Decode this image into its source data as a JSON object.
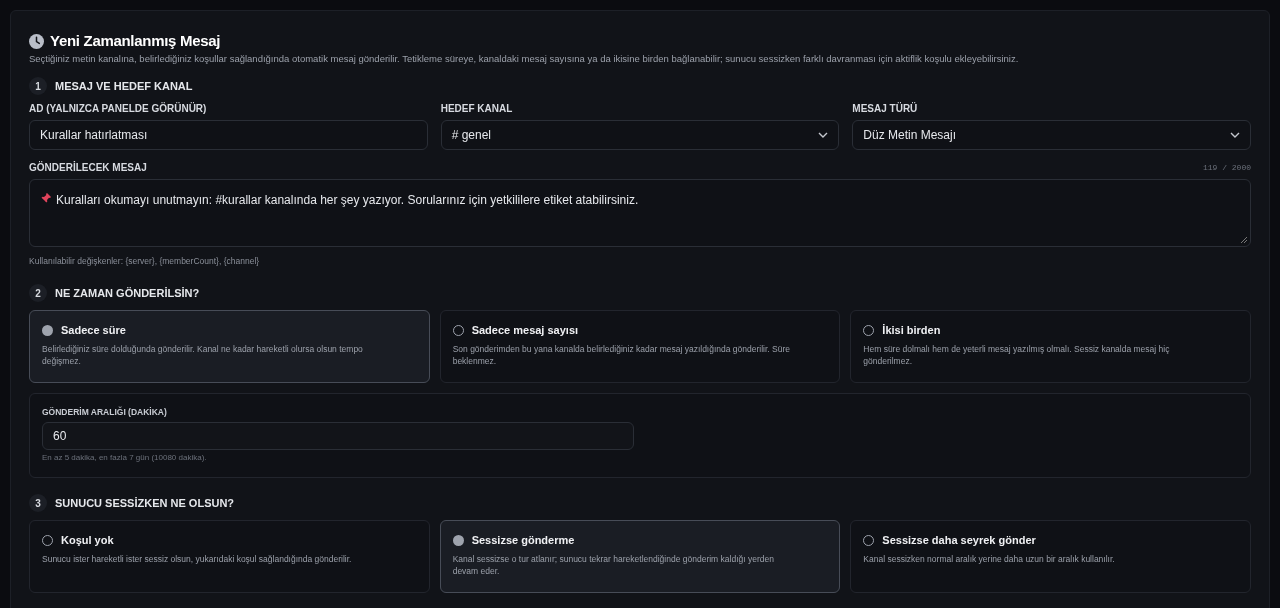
{
  "header": {
    "title": "Yeni Zamanlanmış Mesaj",
    "description": "Seçtiğiniz metin kanalına, belirlediğiniz koşullar sağlandığında otomatik mesaj gönderilir. Tetikleme süreye, kanaldaki mesaj sayısına ya da ikisine birden bağlanabilir; sunucu sessizken farklı davranması için aktiflik koşulu ekleyebilirsiniz."
  },
  "section_1": {
    "number": "1",
    "title": "MESAJ VE HEDEF KANAL",
    "fields": [
      {
        "kind": "text",
        "label": "AD (YALNIZCA PANELDE GÖRÜNÜR)",
        "value": "Kurallar hatırlatması"
      },
      {
        "kind": "select",
        "label": "HEDEF KANAL",
        "value": "# genel"
      },
      {
        "kind": "select",
        "label": "MESAJ TÜRÜ",
        "value": "Düz Metin Mesajı"
      }
    ],
    "message": {
      "label": "GÖNDERİLECEK MESAJ",
      "counter": "119 / 2000",
      "value": "Kuralları okumayı unutmayın: #kurallar kanalında her şey yazıyor. Sorularınız için yetkililere etiket atabilirsiniz.",
      "hint": "Kullanılabilir değişkenler: {server}, {memberCount}, {channel}"
    }
  },
  "section_2": {
    "number": "2",
    "title": "NE ZAMAN GÖNDERİLSİN?",
    "options": [
      {
        "title": "Sadece süre",
        "description": "Belirlediğiniz süre dolduğunda gönderilir. Kanal ne kadar hareketli olursa olsun tempo değişmez.",
        "selected": true
      },
      {
        "title": "Sadece mesaj sayısı",
        "description": "Son gönderimden bu yana kanalda belirlediğiniz kadar mesaj yazıldığında gönderilir. Süre beklenmez.",
        "selected": false
      },
      {
        "title": "İkisi birden",
        "description": "Hem süre dolmalı hem de yeterli mesaj yazılmış olmalı. Sessiz kanalda mesaj hiç gönderilmez.",
        "selected": false
      }
    ],
    "interval": {
      "label": "GÖNDERİM ARALIĞI (DAKİKA)",
      "value": "60",
      "hint": "En az 5 dakika, en fazla 7 gün (10080 dakika)."
    }
  },
  "section_3": {
    "number": "3",
    "title": "SUNUCU SESSİZKEN NE OLSUN?",
    "options": [
      {
        "title": "Koşul yok",
        "description": "Sunucu ister hareketli ister sessiz olsun, yukarıdaki koşul sağlandığında gönderilir.",
        "selected": false
      },
      {
        "title": "Sessizse gönderme",
        "description": "Kanal sessizse o tur atlanır; sunucu tekrar hareketlendiğinde gönderim kaldığı yerden devam eder.",
        "selected": true
      },
      {
        "title": "Sessizse daha seyrek gönder",
        "description": "Kanal sessizken normal aralık yerine daha uzun bir aralık kullanılır.",
        "selected": false
      }
    ]
  }
}
